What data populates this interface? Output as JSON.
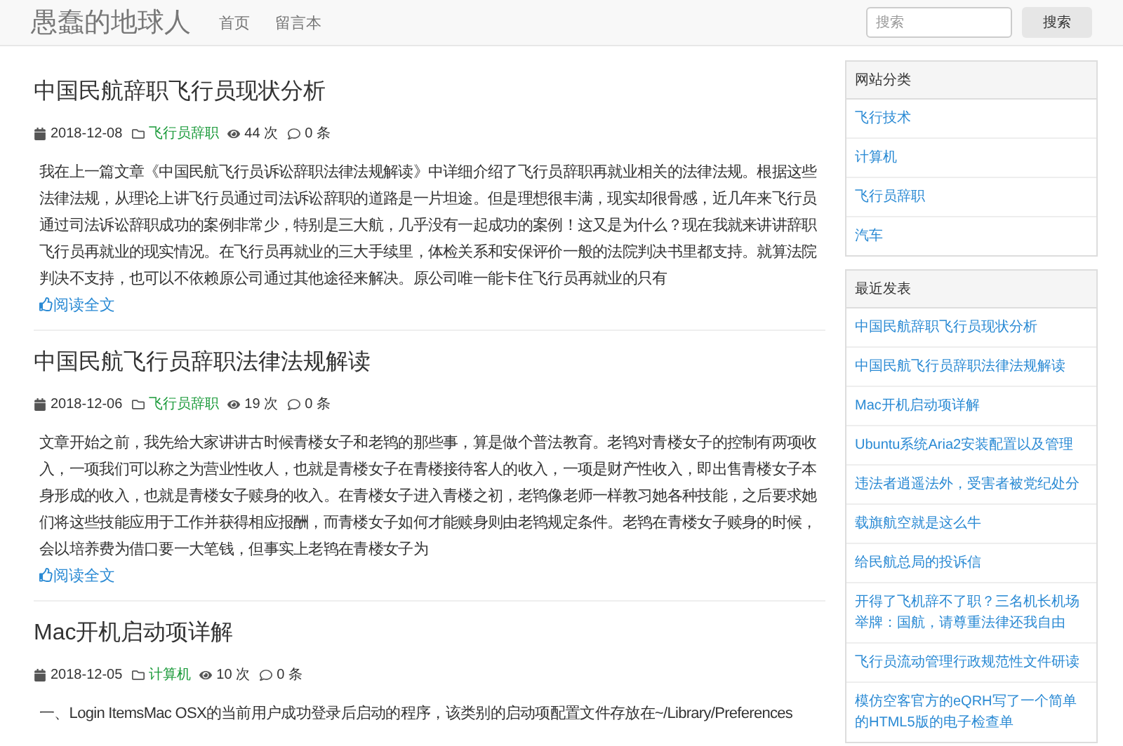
{
  "navbar": {
    "brand": "愚蠢的地球人",
    "links": [
      "首页",
      "留言本"
    ],
    "search": {
      "placeholder": "搜索"
    },
    "search_button": "搜索"
  },
  "articles": [
    {
      "title": "中国民航辞职飞行员现状分析",
      "date": "2018-12-08",
      "category": "飞行员辞职",
      "views": "44 次",
      "comments": "0 条",
      "excerpt": "我在上一篇文章《中国民航飞行员诉讼辞职法律法规解读》中详细介绍了飞行员辞职再就业相关的法律法规。根据这些法律法规，从理论上讲飞行员通过司法诉讼辞职的道路是一片坦途。但是理想很丰满，现实却很骨感，近几年来飞行员通过司法诉讼辞职成功的案例非常少，特别是三大航，几乎没有一起成功的案例！这又是为什么？现在我就来讲讲辞职飞行员再就业的现实情况。在飞行员再就业的三大手续里，体检关系和安保评价一般的法院判决书里都支持。就算法院判决不支持，也可以不依赖原公司通过其他途径来解决。原公司唯一能卡住飞行员再就业的只有",
      "read_more": "阅读全文"
    },
    {
      "title": "中国民航飞行员辞职法律法规解读",
      "date": "2018-12-06",
      "category": "飞行员辞职",
      "views": "19 次",
      "comments": "0 条",
      "excerpt": "文章开始之前，我先给大家讲讲古时候青楼女子和老鸨的那些事，算是做个普法教育。老鸨对青楼女子的控制有两项收入，一项我们可以称之为营业性收人，也就是青楼女子在青楼接待客人的收入，一项是财产性收入，即出售青楼女子本身形成的收入，也就是青楼女子赎身的收入。在青楼女子进入青楼之初，老鸨像老师一样教习她各种技能，之后要求她们将这些技能应用于工作并获得相应报酬，而青楼女子如何才能赎身则由老鸨规定条件。老鸨在青楼女子赎身的时候，会以培养费为借口要一大笔钱，但事实上老鸨在青楼女子为",
      "read_more": "阅读全文"
    },
    {
      "title": "Mac开机启动项详解",
      "date": "2018-12-05",
      "category": "计算机",
      "views": "10 次",
      "comments": "0 条",
      "excerpt": "一、Login ItemsMac OSX的当前用户成功登录后启动的程序，该类别的启动项配置文件存放在~/Library/Preferences"
    }
  ],
  "sidebar": [
    {
      "heading": "网站分类",
      "items": [
        "飞行技术",
        "计算机",
        "飞行员辞职",
        "汽车"
      ]
    },
    {
      "heading": "最近发表",
      "items": [
        "中国民航辞职飞行员现状分析",
        "中国民航飞行员辞职法律法规解读",
        "Mac开机启动项详解",
        "Ubuntu系统Aria2安装配置以及管理",
        "违法者逍遥法外，受害者被党纪处分",
        "载旗航空就是这么牛",
        "给民航总局的投诉信",
        "开得了飞机辞不了职？三名机长机场举牌：国航，请尊重法律还我自由",
        "飞行员流动管理行政规范性文件研读",
        "模仿空客官方的eQRH写了一个简单的HTML5版的电子检查单"
      ]
    }
  ]
}
